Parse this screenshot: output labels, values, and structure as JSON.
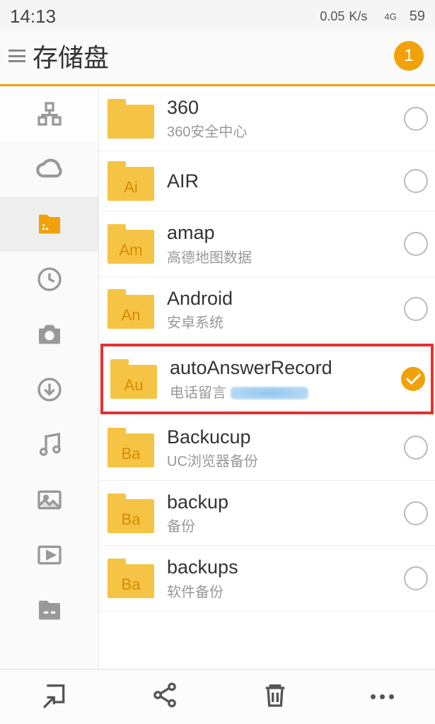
{
  "status": {
    "time": "14:13",
    "net_speed": "0.05",
    "net_unit": "K/s",
    "signal": "4G",
    "battery": "59"
  },
  "header": {
    "title": "存储盘",
    "badge": "1"
  },
  "folders": [
    {
      "tag": "",
      "name": "360",
      "sub": "360安全中心",
      "checked": false,
      "highlight": false
    },
    {
      "tag": "Ai",
      "name": "AIR",
      "sub": "",
      "checked": false,
      "highlight": false
    },
    {
      "tag": "Am",
      "name": "amap",
      "sub": "高德地图数据",
      "checked": false,
      "highlight": false
    },
    {
      "tag": "An",
      "name": "Android",
      "sub": "安卓系统",
      "checked": false,
      "highlight": false
    },
    {
      "tag": "Au",
      "name": "autoAnswerRecord",
      "sub": "电话留言",
      "checked": true,
      "highlight": true
    },
    {
      "tag": "Ba",
      "name": "Backucup",
      "sub": "UC浏览器备份",
      "checked": false,
      "highlight": false
    },
    {
      "tag": "Ba",
      "name": "backup",
      "sub": "备份",
      "checked": false,
      "highlight": false
    },
    {
      "tag": "Ba",
      "name": "backups",
      "sub": "软件备份",
      "checked": false,
      "highlight": false
    }
  ]
}
